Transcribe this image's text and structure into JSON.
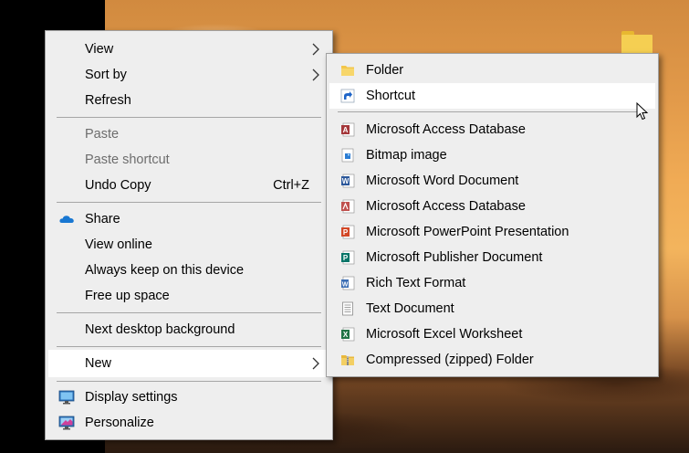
{
  "context_menu": {
    "items": [
      {
        "label": "View"
      },
      {
        "label": "Sort by"
      },
      {
        "label": "Refresh"
      },
      {
        "label": "Paste"
      },
      {
        "label": "Paste shortcut"
      },
      {
        "label": "Undo Copy",
        "shortcut": "Ctrl+Z"
      },
      {
        "label": "Share",
        "icon": "onedrive-cloud-icon"
      },
      {
        "label": "View online"
      },
      {
        "label": "Always keep on this device"
      },
      {
        "label": "Free up space"
      },
      {
        "label": "Next desktop background"
      },
      {
        "label": "New"
      },
      {
        "label": "Display settings",
        "icon": "display-settings-icon"
      },
      {
        "label": "Personalize",
        "icon": "personalize-icon"
      }
    ]
  },
  "new_submenu": {
    "items": [
      {
        "label": "Folder",
        "icon": "folder-icon"
      },
      {
        "label": "Shortcut",
        "icon": "shortcut-icon"
      },
      {
        "label": "Microsoft Access Database",
        "icon": "access-icon"
      },
      {
        "label": "Bitmap image",
        "icon": "bitmap-icon"
      },
      {
        "label": "Microsoft Word Document",
        "icon": "word-icon"
      },
      {
        "label": "Microsoft Access Database",
        "icon": "access-icon"
      },
      {
        "label": "Microsoft PowerPoint Presentation",
        "icon": "powerpoint-icon"
      },
      {
        "label": "Microsoft Publisher Document",
        "icon": "publisher-icon"
      },
      {
        "label": "Rich Text Format",
        "icon": "wordpad-icon"
      },
      {
        "label": "Text Document",
        "icon": "text-document-icon"
      },
      {
        "label": "Microsoft Excel Worksheet",
        "icon": "excel-icon"
      },
      {
        "label": "Compressed (zipped) Folder",
        "icon": "zip-folder-icon"
      }
    ]
  },
  "colors": {
    "menu_bg": "#eeeeee",
    "highlight_bg": "#ffffff",
    "disabled_text": "#6d6d6d",
    "separator": "#a6a6a6"
  }
}
